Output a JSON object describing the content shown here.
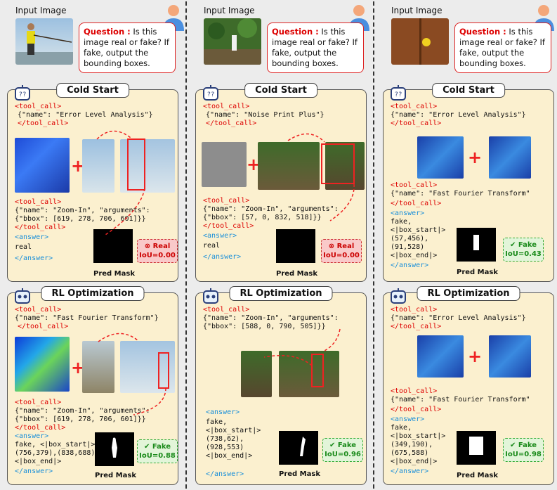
{
  "columns": [
    {
      "input_label": "Input Image",
      "question_prefix": "Question :",
      "question_text": " Is this image real or fake? If fake, output the bounding boxes.",
      "cold": {
        "title": "Cold Start",
        "tool_call_open_1": "<tool_call>",
        "tool_name_1": "{\"name\": \"Error Level Analysis\"}",
        "tool_call_close_1": "</tool_call>",
        "tool_call_open_2": "<tool_call>",
        "tool_name_2": "{\"name\": \"Zoom-In\", \"arguments\":\n{\"bbox\": [619, 278, 706, 601]}}",
        "tool_call_close_2": "</tool_call>",
        "answer_open": "<answer>",
        "answer": "real",
        "answer_close": "</answer>",
        "mask_label": "Pred Mask",
        "badge_label": "Real",
        "badge_iou": "IoU=0.00"
      },
      "rl": {
        "title": "RL Optimization",
        "tool_call_open_1": "<tool_call>",
        "tool_name_1": "{\"name\": \"Fast Fourier Transform\"}",
        "tool_call_close_1": "</tool_call>",
        "tool_call_open_2": "<tool_call>",
        "tool_name_2": "{\"name\": \"Zoom-In\", \"arguments\":\n{\"bbox\": [619, 278, 706, 601]}}",
        "tool_call_close_2": "</tool_call>",
        "answer_open": "<answer>",
        "answer": "fake, <|box_start|>\n(756,379),(838,688)\n<|box_end|>",
        "answer_close": "</answer>",
        "mask_label": "Pred Mask",
        "badge_label": "Fake",
        "badge_iou": "IoU=0.88"
      }
    },
    {
      "input_label": "Input Image",
      "question_prefix": "Question :",
      "question_text": " Is this image real or fake? If fake, output the bounding boxes.",
      "cold": {
        "title": "Cold Start",
        "tool_call_open_1": "<tool_call>",
        "tool_name_1": "{\"name\": \"Noise Print Plus\"}",
        "tool_call_close_1": "</tool_call>",
        "tool_call_open_2": "<tool_call>",
        "tool_name_2": "{\"name\": \"Zoom-In\", \"arguments\":\n{\"bbox\": [57, 0, 832, 518]}}",
        "tool_call_close_2": "</tool_call>",
        "answer_open": "<answer>",
        "answer": "real",
        "answer_close": "</answer>",
        "mask_label": "Pred Mask",
        "badge_label": "Real",
        "badge_iou": "IoU=0.00"
      },
      "rl": {
        "title": "RL Optimization",
        "tool_call_open_1": "<tool_call>",
        "tool_name_1": "{\"name\": \"Zoom-In\", \"arguments\":\n{\"bbox\": [588, 0, 790, 505]}}",
        "tool_call_close_1": "</tool_call>",
        "answer_open": "<answer>",
        "answer": "fake,\n<|box_start|>\n(738,62),\n(928,553)\n<|box_end|>",
        "answer_close": "</answer>",
        "mask_label": "Pred Mask",
        "badge_label": "Fake",
        "badge_iou": "IoU=0.96"
      }
    },
    {
      "input_label": "Input Image",
      "question_prefix": "Question :",
      "question_text": " Is this image real or fake? If fake, output the bounding boxes.",
      "cold": {
        "title": "Cold Start",
        "tool_call_open_1": "<tool_call>",
        "tool_name_1": "{\"name\": \"Error Level Analysis\"}",
        "tool_call_close_1": "</tool_call>",
        "tool_call_open_2": "<tool_call>",
        "tool_name_2": "{\"name\": \"Fast Fourier Transform\"",
        "tool_call_close_2": "</tool_call>",
        "answer_open": "<answer>",
        "answer": "fake,\n<|box_start|>\n(57,456),\n(91,528)\n<|box_end|>",
        "answer_close": "</answer>",
        "mask_label": "Pred Mask",
        "badge_label": "Fake",
        "badge_iou": "IoU=0.43"
      },
      "rl": {
        "title": "RL Optimization",
        "tool_call_open_1": "<tool_call>",
        "tool_name_1": "{\"name\": \"Error Level Analysis\"}",
        "tool_call_close_1": "</tool_call>",
        "tool_call_open_2": "<tool_call>",
        "tool_name_2": "{\"name\": \"Fast Fourier Transform\"",
        "tool_call_close_2": "</tool_call>",
        "answer_open": "<answer>",
        "answer": "fake,\n<|box_start|>\n(349,190),\n(675,588)\n<|box_end|>",
        "answer_close": "</answer>",
        "mask_label": "Pred Mask",
        "badge_label": "Fake",
        "badge_iou": "IoU=0.98"
      }
    }
  ],
  "colors": {
    "tag": "#dd0000",
    "answer_tag": "#1a8fd9",
    "panel_bg": "#fbf0cf",
    "fake_green": "#1a8a1a",
    "real_red": "#cc0000"
  }
}
